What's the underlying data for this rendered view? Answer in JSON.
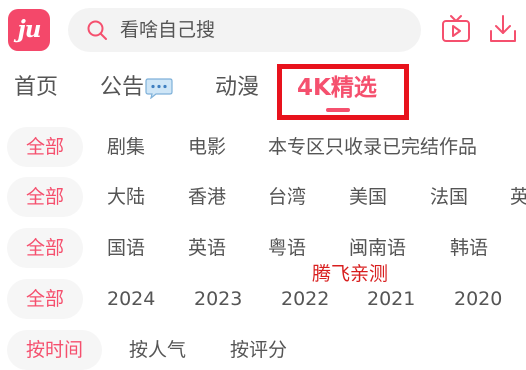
{
  "app": {
    "logo_text": "ju"
  },
  "search": {
    "placeholder": "看啥自己搜",
    "icon": "search-icon"
  },
  "top_icons": [
    "tv-icon",
    "download-icon"
  ],
  "tabs": [
    {
      "label": "首页",
      "active": false
    },
    {
      "label": "公告",
      "active": false,
      "icon": "chat-bubble-icon"
    },
    {
      "label": "动漫",
      "active": false
    },
    {
      "label": "4K精选",
      "active": true
    }
  ],
  "filters": {
    "genre": [
      "全部",
      "剧集",
      "电影",
      "本专区只收录已完结作品"
    ],
    "region": [
      "全部",
      "大陆",
      "香港",
      "台湾",
      "美国",
      "法国",
      "英"
    ],
    "language": [
      "全部",
      "国语",
      "英语",
      "粤语",
      "闽南语",
      "韩语"
    ],
    "year": [
      "全部",
      "2024",
      "2023",
      "2022",
      "2021",
      "2020"
    ],
    "sort": [
      "按时间",
      "按人气",
      "按评分"
    ]
  },
  "watermark": "腾飞亲测",
  "colors": {
    "accent": "#f5506e",
    "logo_bg": "#f4486a",
    "highlight_box": "#e8121c"
  }
}
